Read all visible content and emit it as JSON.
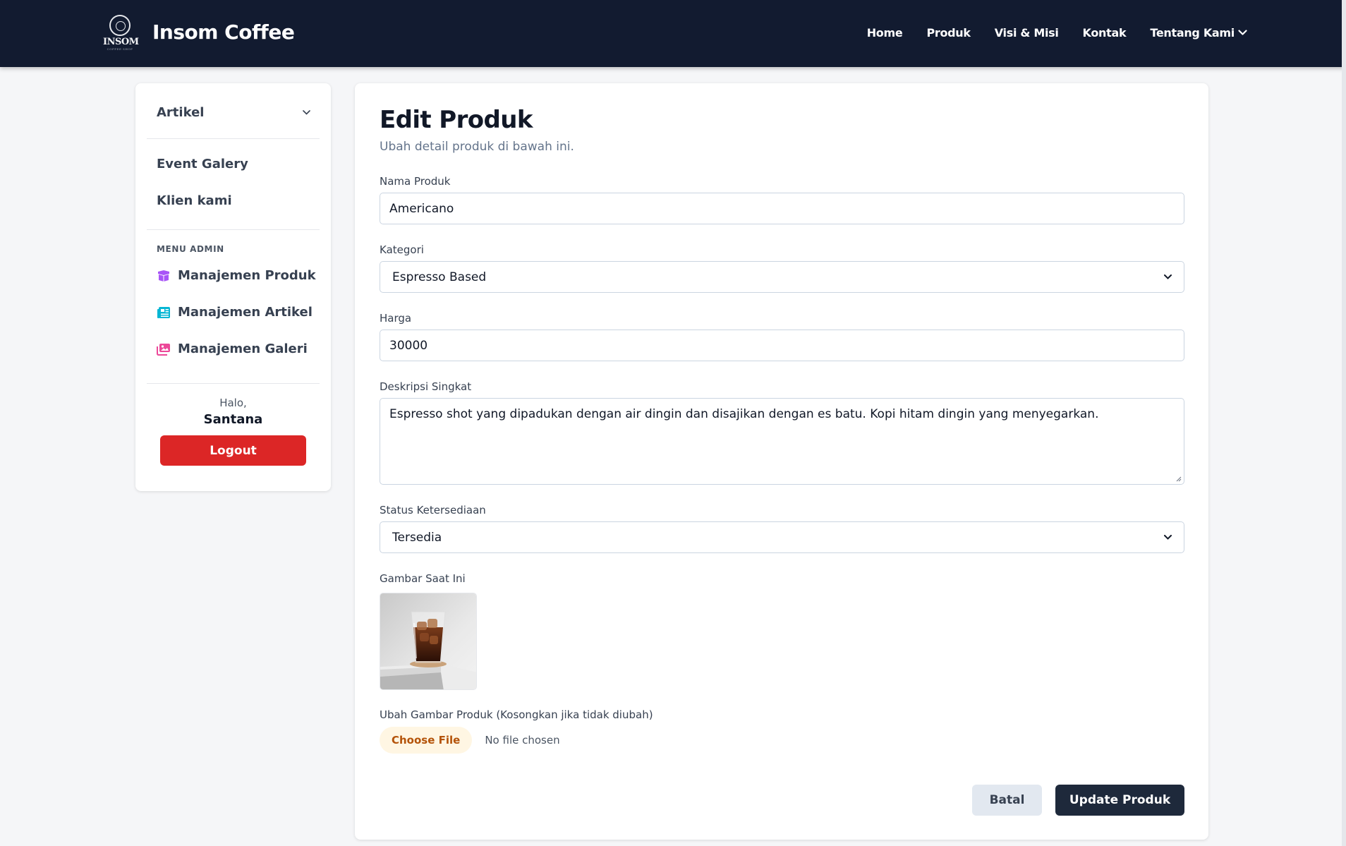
{
  "brand": {
    "logo_text": "INSOM",
    "logo_subtext": "COFFEE SHOP",
    "name": "Insom Coffee"
  },
  "nav": {
    "items": [
      {
        "label": "Home"
      },
      {
        "label": "Produk"
      },
      {
        "label": "Visi & Misi"
      },
      {
        "label": "Kontak"
      },
      {
        "label": "Tentang Kami"
      }
    ]
  },
  "sidebar": {
    "dropdown_label": "Artikel",
    "links": [
      {
        "label": "Event Galery"
      },
      {
        "label": "Klien kami"
      }
    ],
    "section_title": "MENU ADMIN",
    "admin_items": [
      {
        "label": "Manajemen Produk",
        "icon": "box-icon",
        "color": "#a855f7"
      },
      {
        "label": "Manajemen Artikel",
        "icon": "newspaper-icon",
        "color": "#06b6d4"
      },
      {
        "label": "Manajemen Galeri",
        "icon": "images-icon",
        "color": "#ec4899"
      }
    ],
    "greeting": "Halo,",
    "username": "Santana",
    "logout_label": "Logout"
  },
  "form": {
    "title": "Edit Produk",
    "subtitle": "Ubah detail produk di bawah ini.",
    "name_label": "Nama Produk",
    "name_value": "Americano",
    "category_label": "Kategori",
    "category_value": "Espresso Based",
    "price_label": "Harga",
    "price_value": "30000",
    "desc_label": "Deskripsi Singkat",
    "desc_value": "Espresso shot yang dipadukan dengan air dingin dan disajikan dengan es batu. Kopi hitam dingin yang menyegarkan.",
    "status_label": "Status Ketersediaan",
    "status_value": "Tersedia",
    "current_image_label": "Gambar Saat Ini",
    "change_image_label": "Ubah Gambar Produk (Kosongkan jika tidak diubah)",
    "choose_file_label": "Choose File",
    "no_file_label": "No file chosen",
    "cancel_label": "Batal",
    "submit_label": "Update Produk"
  },
  "colors": {
    "navbar_bg": "#121b30",
    "logout_bg": "#dc2626",
    "submit_bg": "#1e293b",
    "choose_file_bg": "#fff6e3",
    "choose_file_text": "#b45309"
  }
}
